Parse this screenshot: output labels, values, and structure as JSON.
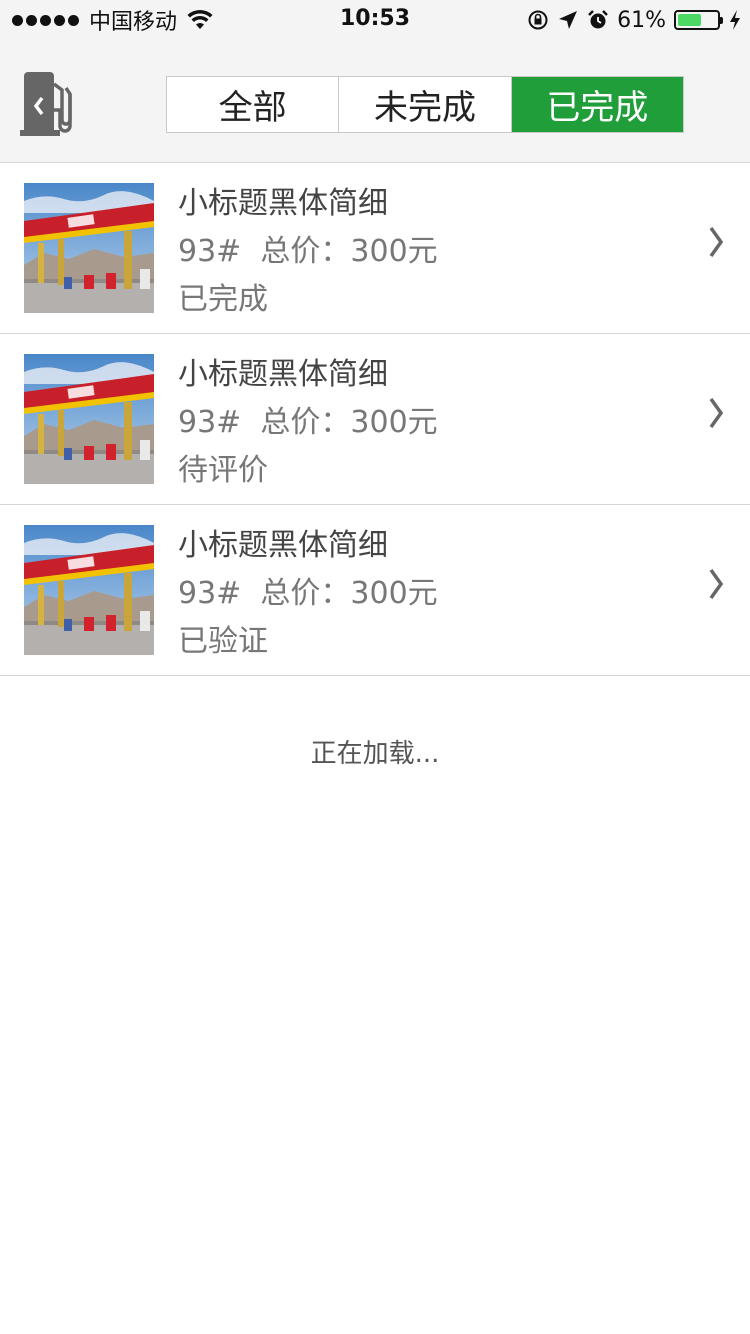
{
  "status_bar": {
    "carrier": "中国移动",
    "time": "10:53",
    "battery_percent": "61%",
    "battery_level": 0.61
  },
  "header": {
    "tabs": [
      {
        "label": "全部",
        "active": false
      },
      {
        "label": "未完成",
        "active": false
      },
      {
        "label": "已完成",
        "active": true
      }
    ]
  },
  "orders": [
    {
      "title": "小标题黑体简细",
      "fuel": "93#",
      "price_label": "总价：300元",
      "status": "已完成"
    },
    {
      "title": "小标题黑体简细",
      "fuel": "93#",
      "price_label": "总价：300元",
      "status": "待评价"
    },
    {
      "title": "小标题黑体简细",
      "fuel": "93#",
      "price_label": "总价：300元",
      "status": "已验证"
    }
  ],
  "loading_text": "正在加载...",
  "colors": {
    "accent": "#1f9e3a",
    "battery": "#4cd964"
  }
}
